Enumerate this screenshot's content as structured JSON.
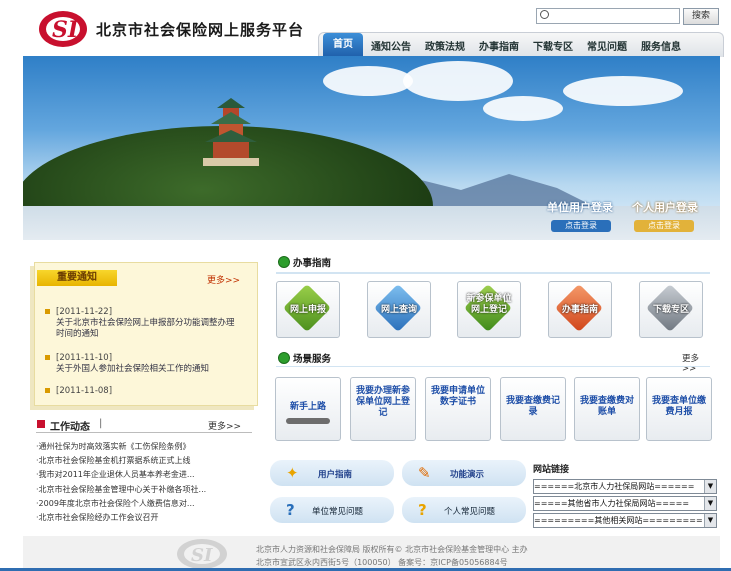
{
  "site": {
    "title": "北京市社会保险网上服务平台",
    "logo_text": "SI"
  },
  "search": {
    "placeholder": "",
    "button": "搜索"
  },
  "nav": [
    "首页",
    "通知公告",
    "政策法规",
    "办事指南",
    "下载专区",
    "常见问题",
    "服务信息"
  ],
  "banner": {
    "corp_login": "单位用户登录",
    "corp_login_btn": "点击登录",
    "person_login": "个人用户登录",
    "person_login_btn": "点击登录"
  },
  "notice": {
    "title": "重要通知",
    "more": "更多>>",
    "items": [
      {
        "date": "[2011-11-22]",
        "text": "关于北京市社会保险网上申报部分功能调整办理时间的通知"
      },
      {
        "date": "[2011-11-10]",
        "text": "关于外国人参加社会保险相关工作的通知"
      },
      {
        "date": "[2011-11-08]",
        "text": ""
      }
    ]
  },
  "news": {
    "title": "工作动态",
    "separator": "|",
    "more": "更多>>",
    "items": [
      "·通州社保为时高效落实新《工伤保险条例》",
      "·北京市社会保险基金机打票据系统正式上线",
      "·我市对2011年企业退休人员基本养老金进...",
      "·北京市社会保险基金管理中心关于补缴各项社...",
      "·2009年度北京市社会保险个人缴费信息对...",
      "·北京市社会保险经办工作会议召开"
    ]
  },
  "guide": {
    "title": "办事指南",
    "tiles": [
      "网上申报",
      "网上查询",
      "新参保单位网上登记",
      "办事指南",
      "下载专区"
    ]
  },
  "scene": {
    "title": "场景服务",
    "more": "更多>>",
    "tiles": [
      "新手上路",
      "我要办理新参保单位网上登记",
      "我要申请单位数字证书",
      "我要查缴费记录",
      "我要查缴费对账单",
      "我要查单位缴费月报"
    ]
  },
  "help": {
    "user_guide": "用户指南",
    "demo": "功能演示",
    "corp_faq": "单位常见问题",
    "person_faq": "个人常见问题"
  },
  "links": {
    "title": "网站链接",
    "options": [
      "======北京市人力社保局网站======",
      "=====其他省市人力社保局网站=====",
      "=========其他相关网站========="
    ]
  },
  "footer": {
    "line1": "北京市人力资源和社会保障局 版权所有© 北京市社会保险基金管理中心 主办",
    "line2": "北京市宣武区永内西街5号（100050） 备案号：京ICP备05056884号"
  },
  "colors": {
    "nav_active": "#2a6fba",
    "notice_bg": "#fdf7d9",
    "accent_red": "#c8102e"
  }
}
